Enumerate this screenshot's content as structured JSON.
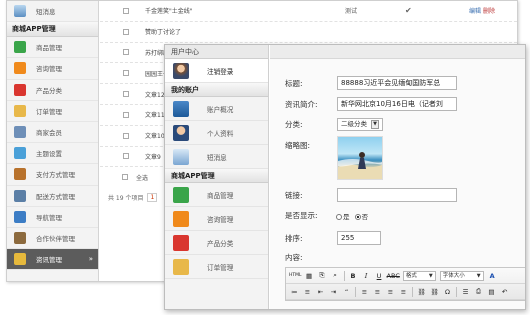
{
  "back": {
    "sidebar": {
      "top_item": "短消息",
      "section": "商城APP管理",
      "items": [
        {
          "label": "商品管理",
          "icon": "grid-icon",
          "color": "#3aa54a"
        },
        {
          "label": "咨询管理",
          "icon": "chat-bubble-icon",
          "color": "#f08a1c"
        },
        {
          "label": "产品分类",
          "icon": "categories-icon",
          "color": "#d9362f"
        },
        {
          "label": "订单管理",
          "icon": "clipboard-icon",
          "color": "#e8b84a"
        },
        {
          "label": "商家会员",
          "icon": "people-icon",
          "color": "#6e8fb8"
        },
        {
          "label": "主题设置",
          "icon": "theme-icon",
          "color": "#4aa0d8"
        },
        {
          "label": "支付方式管理",
          "icon": "wallet-icon",
          "color": "#b8722c"
        },
        {
          "label": "配送方式管理",
          "icon": "truck-icon",
          "color": "#5b7fa6"
        },
        {
          "label": "导航管理",
          "icon": "globe-icon",
          "color": "#3c7dc5"
        },
        {
          "label": "合作伙伴管理",
          "icon": "handshake-icon",
          "color": "#8c6a3e"
        },
        {
          "label": "资讯管理",
          "icon": "folder-icon",
          "color": "#e6b93c",
          "arrow": "»"
        }
      ]
    },
    "rows": [
      {
        "title": "千金莲笑\"土金线\"",
        "cat": "测试",
        "tick": "✔",
        "edit": "编辑",
        "del": "删除"
      },
      {
        "title": "赞助丁讨论了"
      },
      {
        "title": "苏打绑压出了"
      },
      {
        "title": "园园王子：上星"
      },
      {
        "title": "文章12"
      },
      {
        "title": "文章11"
      },
      {
        "title": "文章10"
      },
      {
        "title": "文章9"
      }
    ],
    "select_all": "全选",
    "pager": "共 19 个项目",
    "pager_current": "1"
  },
  "front": {
    "sidebar": {
      "user_center": "用户中心",
      "login": "注销登录",
      "my_account": "我的账户",
      "account_items": [
        {
          "label": "账户概况",
          "icon": "house-icon"
        },
        {
          "label": "个人资料",
          "icon": "user-icon"
        },
        {
          "label": "短消息",
          "icon": "monitor-icon"
        }
      ],
      "app_section": "商城APP管理",
      "app_items": [
        {
          "label": "商品管理",
          "icon": "grid-icon",
          "color": "#3aa54a"
        },
        {
          "label": "咨询管理",
          "icon": "chat-bubble-icon",
          "color": "#f08a1c"
        },
        {
          "label": "产品分类",
          "icon": "categories-icon",
          "color": "#d9362f"
        },
        {
          "label": "订单管理",
          "icon": "clipboard-icon",
          "color": "#e8b84a"
        }
      ]
    },
    "form": {
      "title_label": "标题:",
      "title_value": "88888习近平会见缅甸国防军总",
      "intro_label": "资讯简介:",
      "intro_value": "新华网北京10月16日电（记者刘",
      "category_label": "分类:",
      "category_value": "二级分类",
      "image_label": "缩略图:",
      "link_label": "链接:",
      "link_value": "",
      "show_label": "是否显示:",
      "yes": "是",
      "no": "否",
      "sort_label": "排序:",
      "sort_value": "255",
      "content_label": "内容:"
    },
    "editor": {
      "row1": [
        "HTML",
        "▦",
        "⎘",
        "⌕",
        "B",
        "I",
        "U",
        "ABC"
      ],
      "format_label": "格式",
      "font_label": "字体大小",
      "row2": [
        "≔",
        "≡",
        "⇤",
        "⇥",
        "“",
        "≡",
        "≡",
        "≡",
        "≡",
        "⛓",
        "⛓",
        "Ω",
        "☰",
        "⎙",
        "▤",
        "↶"
      ],
      "font_color": "A"
    }
  }
}
